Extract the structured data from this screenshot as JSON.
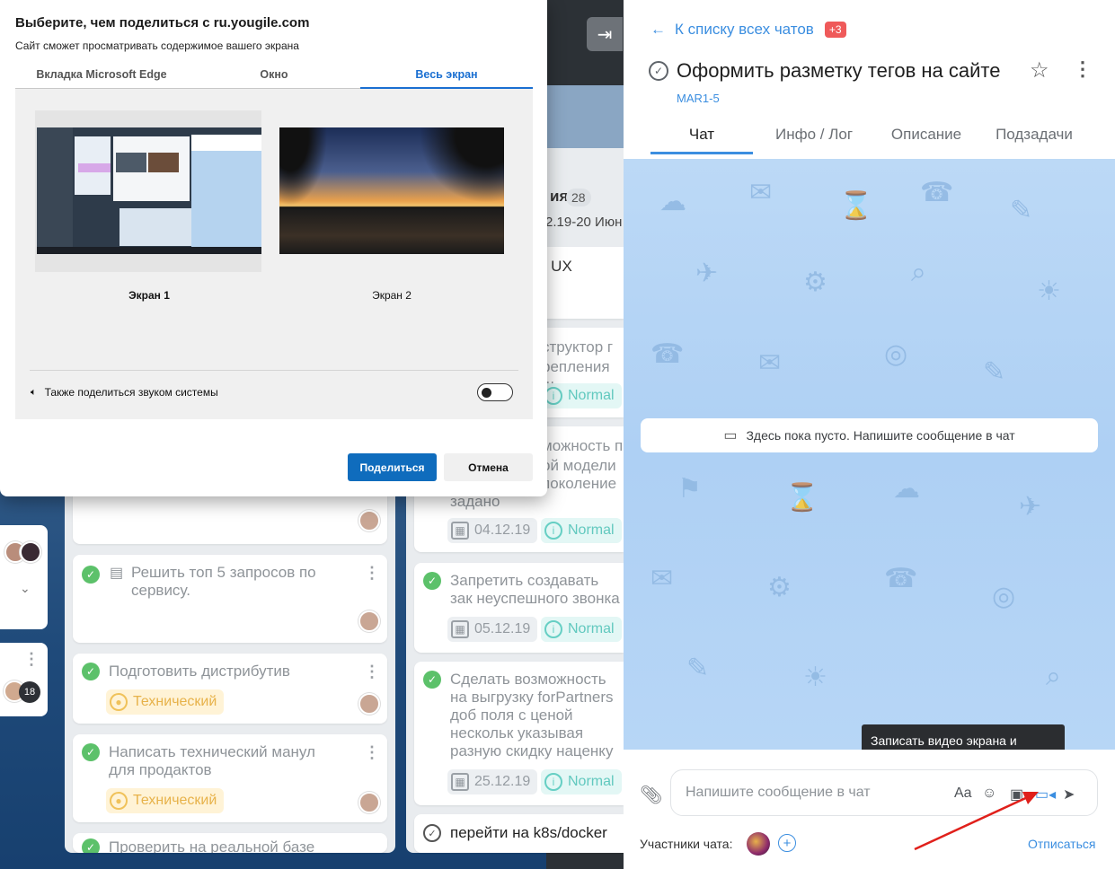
{
  "dialog": {
    "title": "Выберите, чем поделиться с ru.yougile.com",
    "subtitle": "Сайт сможет просматривать содержимое вашего экрана",
    "tabs": [
      "Вкладка Microsoft Edge",
      "Окно",
      "Весь экран"
    ],
    "active_tab": "Весь экран",
    "screens": [
      "Экран 1",
      "Экран 2"
    ],
    "share_audio_label": "Также поделиться звуком системы",
    "share_audio_on": false,
    "share_button": "Поделиться",
    "cancel_button": "Отмена"
  },
  "board": {
    "column_header_fragment": "ия",
    "column_count": "28",
    "column_dates_fragment": "2.19-20 Июн",
    "fragments": [
      "е UX",
      "структор г",
      "репления ш",
      "можность п",
      "ой модели",
      "поколение",
      "задано"
    ],
    "left_badge": "18",
    "left_cards": [
      {
        "title": "Решить топ 5 запросов по сервису."
      },
      {
        "title": "Подготовить дистрибутив",
        "tag": "Технический"
      },
      {
        "title": "Написать технический манул для продактов",
        "tag": "Технический"
      },
      {
        "title": "Проверить на реальной базе"
      }
    ],
    "right_cards": [
      {
        "date": "04.12.19",
        "priority": "Normal"
      },
      {
        "title": "Запретить создавать зак неуспешного звонка",
        "date": "05.12.19",
        "priority": "Normal"
      },
      {
        "title": "Сделать возможность на выгрузку forPartners доб поля с ценой нескольк указывая разную скидку наценку",
        "date": "25.12.19",
        "priority": "Normal"
      },
      {
        "title": "перейти на k8s/docker"
      }
    ],
    "top_priority": "Normal"
  },
  "chat": {
    "back_link": "К списку всех чатов",
    "unread_badge": "+3",
    "task_title": "Оформить разметку тегов на сайте",
    "task_id": "MAR1-5",
    "tabs": [
      "Чат",
      "Инфо / Лог",
      "Описание",
      "Подзадачи"
    ],
    "active_tab": "Чат",
    "empty_message": "Здесь пока пусто. Напишите сообщение в чат",
    "tooltip": "Записать видео экрана и отправить в чат",
    "input_placeholder": "Напишите сообщение в чат",
    "format_icon_text": "Aa",
    "participants_label": "Участники чата:",
    "unsubscribe": "Отписаться"
  },
  "colors": {
    "accent": "#3b8ee0",
    "edge_blue": "#0f6cbd",
    "done_green": "#5cc16a",
    "badge_red": "#ef5a5a",
    "annotation_arrow": "#e0201b"
  }
}
